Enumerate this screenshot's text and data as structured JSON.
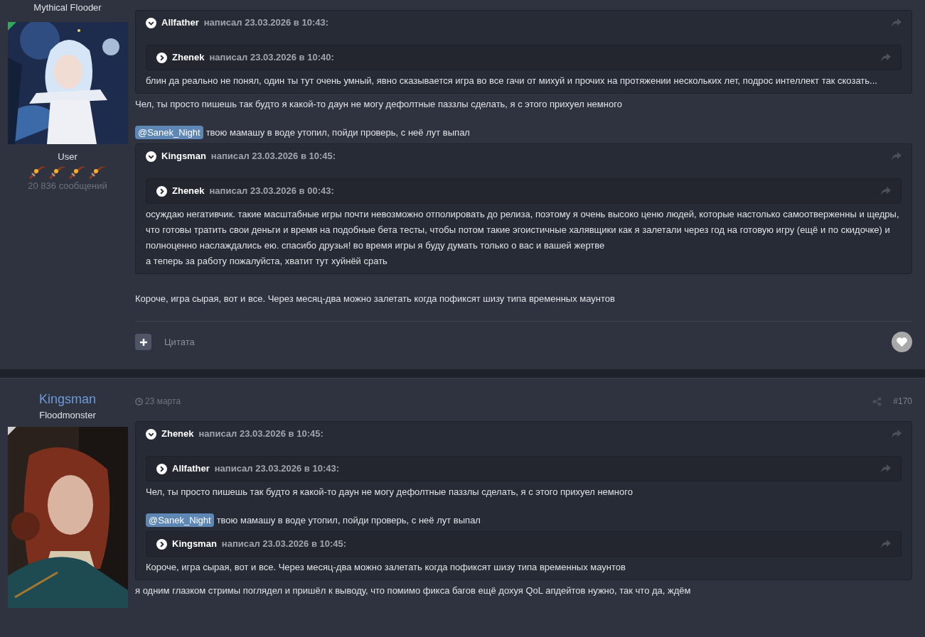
{
  "posts": [
    {
      "author": {
        "title": "Mythical Flooder",
        "online": true,
        "group": "User",
        "message_count": "20 836 сообщений"
      },
      "content": [
        {
          "kind": "quote",
          "expanded": true,
          "author": "Allfather",
          "meta": "написал 23.03.2026 в 10:43:",
          "body": [
            {
              "kind": "quote",
              "expanded": false,
              "author": "Zhenek",
              "meta": "написал 23.03.2026 в 10:40:"
            },
            {
              "kind": "text",
              "text": "блин да реально не понял, один ты тут очень умный, явно сказывается игра во все гачи от михуй и прочих на протяжении нескольких лет, подрос интеллект так скозать..."
            }
          ]
        },
        {
          "kind": "text",
          "text": "Чел, ты просто пишешь так будто я какой-то даун не могу дефолтные паззлы сделать, я с этого прихуел немного"
        },
        {
          "kind": "mention",
          "mention": "@Sanek_Night",
          "text": "твою мамашу в воде утопил, пойди проверь, с неё лут выпал"
        },
        {
          "kind": "quote",
          "expanded": true,
          "author": "Kingsman",
          "meta": "написал 23.03.2026 в 10:45:",
          "body": [
            {
              "kind": "quote",
              "expanded": false,
              "author": "Zhenek",
              "meta": "написал 23.03.2026 в 00:43:"
            },
            {
              "kind": "text",
              "text": "осуждаю негативчик. такие масштабные игры почти невозможно отполировать до релиза, поэтому я очень высоко ценю людей, которые настолько самоотверженны и щедры, что готовы тратить свои деньги и время на подобные бета тесты, чтобы потом такие эгоистичные халявщики как я залетали через год на готовую игру (ещё и по скидочке) и полноценно наслаждались ею. спасибо друзья! во время игры я буду думать только о вас и вашей жертве\nа теперь за работу пожалуйста, хватит тут хуйнёй срать"
            }
          ]
        },
        {
          "kind": "text",
          "text": "Короче, игра сырая, вот и все. Через месяц-два можно залетать когда пофиксят шизу типа временных маунтов"
        }
      ],
      "footer": {
        "quote_label": "Цитата"
      }
    },
    {
      "author": {
        "name": "Kingsman",
        "title": "Floodmonster",
        "online": false
      },
      "date": "23 марта",
      "number": "#170",
      "content": [
        {
          "kind": "quote",
          "expanded": true,
          "author": "Zhenek",
          "meta": "написал 23.03.2026 в 10:45:",
          "body": [
            {
              "kind": "quote",
              "expanded": false,
              "author": "Allfather",
              "meta": "написал 23.03.2026 в 10:43:"
            },
            {
              "kind": "text",
              "text": "Чел, ты просто пишешь так будто я какой-то даун не могу дефолтные паззлы сделать, я с этого прихуел немного"
            },
            {
              "kind": "mention",
              "mention": "@Sanek_Night",
              "text": "твою мамашу в воде утопил, пойди проверь, с неё лут выпал"
            },
            {
              "kind": "quote",
              "expanded": false,
              "author": "Kingsman",
              "meta": "написал 23.03.2026 в 10:45:"
            },
            {
              "kind": "text",
              "text": "Короче, игра сырая, вот и все. Через месяц-два можно залетать когда пофиксят шизу типа временных маунтов"
            }
          ]
        },
        {
          "kind": "text",
          "text": "я одним глазком стримы поглядел и пришёл к выводу, что помимо фикса багов ещё дохуя QoL апдейтов нужно, так что да, ждём"
        }
      ]
    }
  ]
}
